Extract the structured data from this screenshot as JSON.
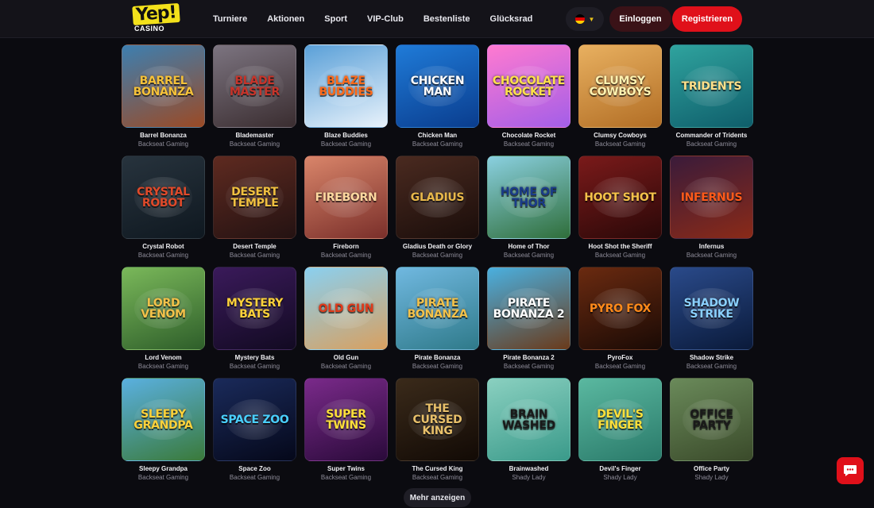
{
  "header": {
    "logo_text": "Yep!",
    "logo_sub": "CASINO",
    "nav": [
      "Turniere",
      "Aktionen",
      "Sport",
      "VIP-Club",
      "Bestenliste",
      "Glücksrad"
    ],
    "language": "de",
    "login_label": "Einloggen",
    "register_label": "Registrieren"
  },
  "colors": {
    "accent_red": "#e0101a",
    "logo_yellow": "#f3e11b",
    "background": "#0b0b10"
  },
  "games": [
    {
      "name": "Barrel Bonanza",
      "provider": "Backseat Gaming",
      "art": "Barrel Bonanza",
      "bg1": "#3d7fb0",
      "bg2": "#9b4a25",
      "fg": "#f6c23a"
    },
    {
      "name": "Blademaster",
      "provider": "Backseat Gaming",
      "art": "Blade Master",
      "bg1": "#7c7480",
      "bg2": "#3a2d30",
      "fg": "#c8342a"
    },
    {
      "name": "Blaze Buddies",
      "provider": "Backseat Gaming",
      "art": "Blaze Buddies",
      "bg1": "#5aa0d8",
      "bg2": "#e8f2fb",
      "fg": "#ff6a1a"
    },
    {
      "name": "Chicken Man",
      "provider": "Backseat Gaming",
      "art": "Chicken Man",
      "bg1": "#1f7bd8",
      "bg2": "#0a3d8e",
      "fg": "#ffffff"
    },
    {
      "name": "Chocolate Rocket",
      "provider": "Backseat Gaming",
      "art": "Chocolate Rocket",
      "bg1": "#ff7ad0",
      "bg2": "#a35ee8",
      "fg": "#ffe14a"
    },
    {
      "name": "Clumsy Cowboys",
      "provider": "Backseat Gaming",
      "art": "Clumsy Cowboys",
      "bg1": "#e8b060",
      "bg2": "#b26e25",
      "fg": "#fff2b0"
    },
    {
      "name": "Commander of Tridents",
      "provider": "Backseat Gaming",
      "art": "Tridents",
      "bg1": "#2fa39e",
      "bg2": "#0f5e6b",
      "fg": "#ffe08a"
    },
    {
      "name": "Crystal Robot",
      "provider": "Backseat Gaming",
      "art": "Crystal Robot",
      "bg1": "#27333d",
      "bg2": "#0f1820",
      "fg": "#e04a2a"
    },
    {
      "name": "Desert Temple",
      "provider": "Backseat Gaming",
      "art": "Desert Temple",
      "bg1": "#5e2a20",
      "bg2": "#241212",
      "fg": "#f0c040"
    },
    {
      "name": "Fireborn",
      "provider": "Backseat Gaming",
      "art": "Fireborn",
      "bg1": "#d9856a",
      "bg2": "#7a2f2a",
      "fg": "#ffd9a0"
    },
    {
      "name": "Gladius Death or Glory",
      "provider": "Backseat Gaming",
      "art": "Gladius",
      "bg1": "#4a2a20",
      "bg2": "#1a0d0a",
      "fg": "#e8b84a"
    },
    {
      "name": "Home of Thor",
      "provider": "Backseat Gaming",
      "art": "Home of Thor",
      "bg1": "#8ad0e0",
      "bg2": "#2f6e3a",
      "fg": "#1a3b8a"
    },
    {
      "name": "Hoot Shot the Sheriff",
      "provider": "Backseat Gaming",
      "art": "Hoot Shot",
      "bg1": "#7a1a1a",
      "bg2": "#2a0808",
      "fg": "#f4c24a"
    },
    {
      "name": "Infernus",
      "provider": "Backseat Gaming",
      "art": "Infernus",
      "bg1": "#3a1b3a",
      "bg2": "#8a2a18",
      "fg": "#ff5a1a"
    },
    {
      "name": "Lord Venom",
      "provider": "Backseat Gaming",
      "art": "Lord Venom",
      "bg1": "#7ab85a",
      "bg2": "#2e5e2a",
      "fg": "#f4c24a"
    },
    {
      "name": "Mystery Bats",
      "provider": "Backseat Gaming",
      "art": "Mystery Bats",
      "bg1": "#3a1a5a",
      "bg2": "#120a22",
      "fg": "#ffd23a"
    },
    {
      "name": "Old Gun",
      "provider": "Backseat Gaming",
      "art": "Old Gun",
      "bg1": "#8ad0f0",
      "bg2": "#d8a060",
      "fg": "#e03a1a"
    },
    {
      "name": "Pirate Bonanza",
      "provider": "Backseat Gaming",
      "art": "Pirate Bonanza",
      "bg1": "#70b8e0",
      "bg2": "#2f7a8a",
      "fg": "#f4c24a"
    },
    {
      "name": "Pirate Bonanza 2",
      "provider": "Backseat Gaming",
      "art": "Pirate Bonanza 2",
      "bg1": "#4ab0e0",
      "bg2": "#6a3a1a",
      "fg": "#ffffff"
    },
    {
      "name": "PyroFox",
      "provider": "Backseat Gaming",
      "art": "Pyro Fox",
      "bg1": "#6a2a10",
      "bg2": "#1a0a05",
      "fg": "#ff8a1a"
    },
    {
      "name": "Shadow Strike",
      "provider": "Backseat Gaming",
      "art": "Shadow Strike",
      "bg1": "#2a4a8a",
      "bg2": "#0a1a3a",
      "fg": "#8ad0ff"
    },
    {
      "name": "Sleepy Grandpa",
      "provider": "Backseat Gaming",
      "art": "Sleepy Grandpa",
      "bg1": "#5ab0e0",
      "bg2": "#3a7a3a",
      "fg": "#ffd23a"
    },
    {
      "name": "Space Zoo",
      "provider": "Backseat Gaming",
      "art": "Space Zoo",
      "bg1": "#1a2a5a",
      "bg2": "#05081a",
      "fg": "#4ad0ff"
    },
    {
      "name": "Super Twins",
      "provider": "Backseat Gaming",
      "art": "Super Twins",
      "bg1": "#7a2a8a",
      "bg2": "#2a0a3a",
      "fg": "#ffe03a"
    },
    {
      "name": "The Cursed King",
      "provider": "Backseat Gaming",
      "art": "The Cursed King",
      "bg1": "#3a2a1a",
      "bg2": "#120a05",
      "fg": "#e8c06a"
    },
    {
      "name": "Brainwashed",
      "provider": "Shady Lady",
      "art": "Brain Washed",
      "bg1": "#8ad0c0",
      "bg2": "#3a9a8a",
      "fg": "#1a1a1a"
    },
    {
      "name": "Devil's Finger",
      "provider": "Shady Lady",
      "art": "Devil's Finger",
      "bg1": "#5ab8a0",
      "bg2": "#2a7a6a",
      "fg": "#ffe03a"
    },
    {
      "name": "Office Party",
      "provider": "Shady Lady",
      "art": "Office Party",
      "bg1": "#6a8a5a",
      "bg2": "#3a4a2a",
      "fg": "#1a1a1a"
    }
  ],
  "more_label": "Mehr anzeigen",
  "chat_icon": "chat-bubble-icon"
}
